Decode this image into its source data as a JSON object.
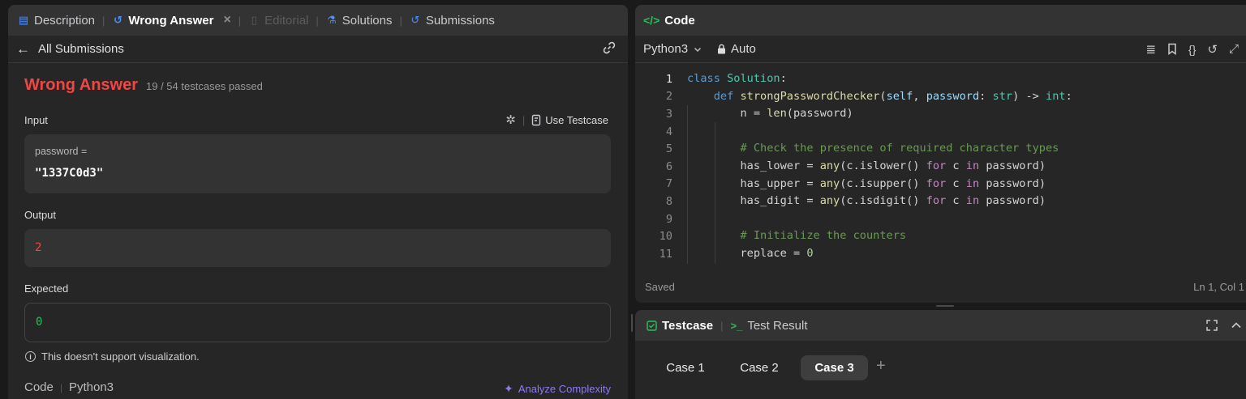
{
  "left": {
    "tabs": [
      {
        "label": "Description",
        "icon": "description-icon"
      },
      {
        "label": "Wrong Answer",
        "icon": "history-icon"
      },
      {
        "label": "Editorial",
        "icon": "book-icon"
      },
      {
        "label": "Solutions",
        "icon": "flask-icon"
      },
      {
        "label": "Submissions",
        "icon": "history-icon"
      }
    ],
    "back_label": "All Submissions",
    "result": {
      "status": "Wrong Answer",
      "summary": "19 / 54 testcases passed"
    },
    "input_label": "Input",
    "use_testcase_label": "Use Testcase",
    "input_var": "password =",
    "input_value": "\"1337C0d3\"",
    "output_label": "Output",
    "output_value": "2",
    "expected_label": "Expected",
    "expected_value": "0",
    "viz_note": "This doesn't support visualization.",
    "code_label": "Code",
    "code_lang": "Python3",
    "analyze_label": "Analyze Complexity"
  },
  "editor": {
    "title": "Code",
    "language": "Python3",
    "mode": "Auto",
    "status_left": "Saved",
    "status_right": "Ln 1, Col 1",
    "line_numbers": [
      "1",
      "2",
      "3",
      "4",
      "5",
      "6",
      "7",
      "8",
      "9",
      "10",
      "11"
    ]
  },
  "testcase": {
    "tab_testcase": "Testcase",
    "tab_result": "Test Result",
    "cases": [
      "Case 1",
      "Case 2",
      "Case 3"
    ],
    "add": "+"
  },
  "colors": {
    "wrong": "#ef4743",
    "correct": "#2cbb5d",
    "accent_blue": "#4f8ff7",
    "analyze_purple": "#8a7bf4"
  }
}
